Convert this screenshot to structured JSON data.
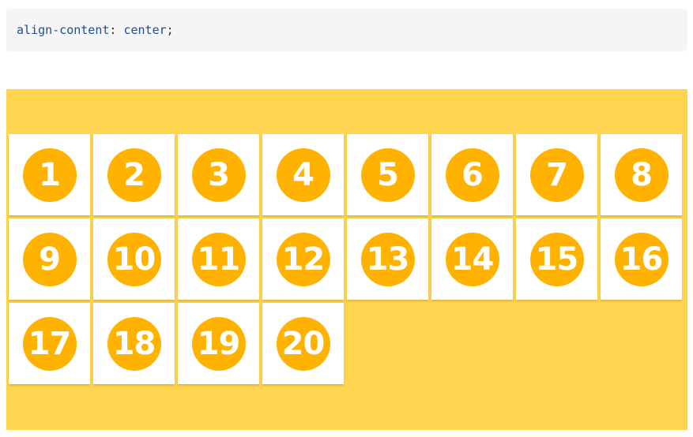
{
  "code": {
    "property": "align-content",
    "separator": ": ",
    "value": "center",
    "terminator": ";"
  },
  "colors": {
    "container_background": "#ffd44f",
    "badge": "#ffb300",
    "item_background": "#ffffff",
    "code_background": "#f5f5f5",
    "code_text": "#1f4e8c"
  },
  "items": [
    "1",
    "2",
    "3",
    "4",
    "5",
    "6",
    "7",
    "8",
    "9",
    "10",
    "11",
    "12",
    "13",
    "14",
    "15",
    "16",
    "17",
    "18",
    "19",
    "20"
  ]
}
